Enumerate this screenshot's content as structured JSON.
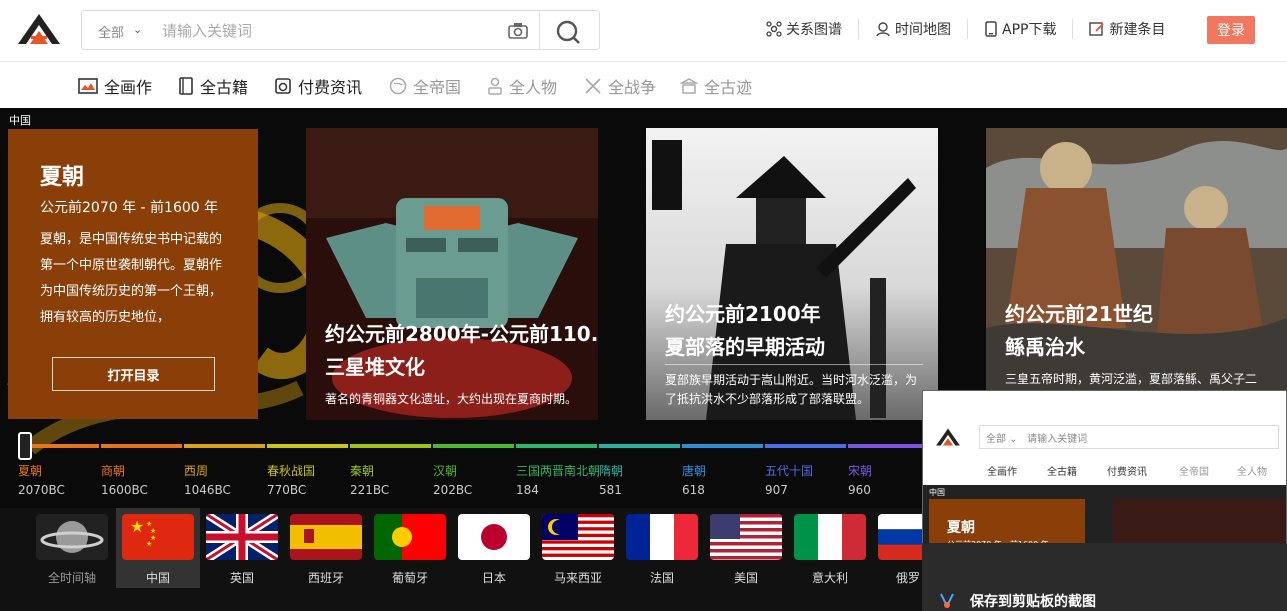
{
  "header": {
    "search": {
      "scope": "全部",
      "placeholder": "请输入关键词"
    },
    "links": [
      "关系图谱",
      "时间地图",
      "APP下载",
      "新建条目"
    ],
    "login": "登录"
  },
  "subnav": [
    "全画作",
    "全古籍",
    "付费资讯",
    "全帝国",
    "全人物",
    "全战争",
    "全古迹"
  ],
  "crumb": "中国",
  "dynasty": {
    "title": "夏朝",
    "dates": "公元前2070 年 - 前1600 年",
    "desc": "夏朝，是中国传统史书中记载的第一个中原世袭制朝代。夏朝作为中国传统历史的第一个王朝，拥有较高的历史地位，",
    "open_btn": "打开目录"
  },
  "cards": [
    {
      "date": "约公元前2800年-公元前110...",
      "name": "三星堆文化",
      "sub": "著名的青铜器文化遗址，大约出现在夏商时期。"
    },
    {
      "date": "约公元前2100年",
      "name": "夏部落的早期活动",
      "sub": "夏部族早期活动于嵩山附近。当时河水泛滥，为了抵抗洪水不少部落形成了部落联盟。"
    },
    {
      "date": "约公元前21世纪",
      "name": "鲧禹治水",
      "sub": "三皇五帝时期，黄河泛滥，夏部落鲧、禹父子二人奉命负责治水。"
    }
  ],
  "timeline": [
    {
      "name": "夏朝",
      "year": "2070BC",
      "color": "#e8731c"
    },
    {
      "name": "商朝",
      "year": "1600BC",
      "color": "#e8731c"
    },
    {
      "name": "西周",
      "year": "1046BC",
      "color": "#d9a21a"
    },
    {
      "name": "春秋战国",
      "year": "770BC",
      "color": "#c9c51b"
    },
    {
      "name": "秦朝",
      "year": "221BC",
      "color": "#9fc31c"
    },
    {
      "name": "汉朝",
      "year": "202BC",
      "color": "#4cba2b"
    },
    {
      "name": "三国两晋南北朝",
      "year": "184",
      "color": "#2bb86b"
    },
    {
      "name": "隋朝",
      "year": "581",
      "color": "#2bb0a6"
    },
    {
      "name": "唐朝",
      "year": "618",
      "color": "#2d8fd8"
    },
    {
      "name": "五代十国",
      "year": "907",
      "color": "#4a6fe8"
    },
    {
      "name": "宋朝",
      "year": "960",
      "color": "#7a55e0"
    }
  ],
  "countries": [
    "全时间轴",
    "中国",
    "英国",
    "西班牙",
    "葡萄牙",
    "日本",
    "马来西亚",
    "法国",
    "美国",
    "意大利",
    "俄罗"
  ],
  "overlay": {
    "scope": "全部",
    "placeholder": "请输入关键词",
    "subnav": [
      "全画作",
      "全古籍",
      "付费资讯",
      "全帝国",
      "全人物"
    ],
    "crumb": "中国",
    "title": "夏朝",
    "dates": "公元前2070 年 - 前1600 年"
  },
  "toast": "保存到剪贴板的截图"
}
